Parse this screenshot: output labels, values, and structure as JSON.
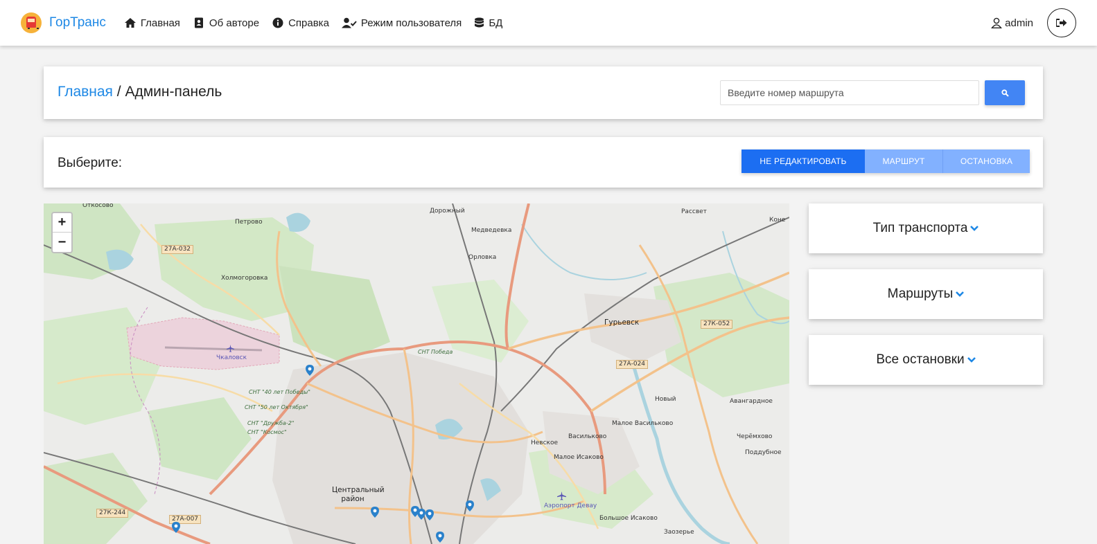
{
  "nav": {
    "brand": "ГорТранс",
    "items": [
      {
        "label": "Главная",
        "icon": "home-icon"
      },
      {
        "label": "Об авторе",
        "icon": "contact-card-icon"
      },
      {
        "label": "Справка",
        "icon": "info-icon"
      },
      {
        "label": "Режим пользователя",
        "icon": "user-check-icon"
      },
      {
        "label": "БД",
        "icon": "database-icon"
      }
    ],
    "user": "admin",
    "logout_icon": "sign-out-icon"
  },
  "breadcrumb": {
    "home": "Главная",
    "separator": " / ",
    "current": "Админ-панель"
  },
  "search": {
    "placeholder": "Введите номер маршрута",
    "value": "",
    "button_icon": "search-icon"
  },
  "mode": {
    "label": "Выберите:",
    "buttons": [
      "НЕ РЕДАКТИРОВАТЬ",
      "МАРШРУТ",
      "ОСТАНОВКА"
    ],
    "active_index": 0
  },
  "map": {
    "zoom_in": "+",
    "zoom_out": "−",
    "places": [
      "Откосово",
      "Петрово",
      "Холмогоровка",
      "Дорожный",
      "Медведевка",
      "Орловка",
      "Рассвет",
      "Коне",
      "Гурьевск",
      "Новый",
      "Авангардное",
      "Малое Васильково",
      "Васильково",
      "Невское",
      "Малое Исаково",
      "Черёмхово",
      "Поддубное",
      "Большое Исаково",
      "Заозерье",
      "Центральный район"
    ],
    "areas": [
      "Чкаловск",
      "СНТ Победа",
      "СНТ \"40 лет Победы\"",
      "СНТ \"50 лет Октября\"",
      "СНТ \"Дружба-2\"",
      "СНТ \"Космос\"",
      "Аэропорт Девау"
    ],
    "roads": [
      "27А-032",
      "27К-052",
      "27А-024",
      "27К-244",
      "27А-007"
    ]
  },
  "filters": [
    {
      "label": "Тип транспорта"
    },
    {
      "label": "Маршруты"
    },
    {
      "label": "Все остановки"
    }
  ],
  "colors": {
    "brand": "#1e88e5",
    "accent": "#4285f4",
    "button_active": "#1c6ef2",
    "button_inactive": "#82b1ff"
  }
}
